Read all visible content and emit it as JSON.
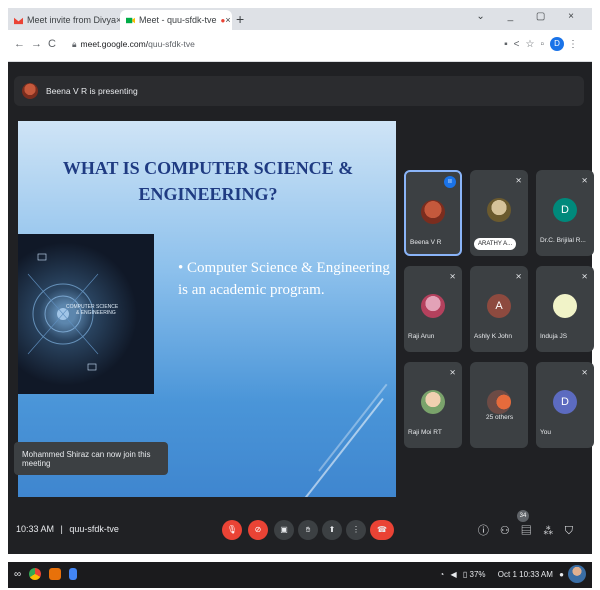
{
  "browser": {
    "tabs": [
      {
        "title": "Meet invite from Divya",
        "close": "×",
        "icon": "gmail-icon"
      },
      {
        "title": "Meet - quu-sfdk-tve",
        "close": "×",
        "icon": "meet-icon"
      }
    ],
    "new_tab": "+",
    "url_domain": "meet.google.com/",
    "url_path": "quu-sfdk-tve"
  },
  "meet": {
    "presenter_banner": "Beena V R is presenting",
    "slide": {
      "title": "WHAT IS COMPUTER SCIENCE & ENGINEERING?",
      "image_text_1": "COMPUTER SCIENCE",
      "image_text_2": "& ENGINEERING",
      "bullet": "• Computer Science & Engineering is an academic program."
    },
    "toast": "Mohammed Shiraz can now join this meeting",
    "participants": [
      {
        "name": "Beena V R",
        "speaking": true
      },
      {
        "name": "ARATHY A...",
        "pinned_label": true
      },
      {
        "name": "Dr.C. Brijilal R...",
        "initial": "D"
      },
      {
        "name": "Raji Arun"
      },
      {
        "name": "Ashly K John",
        "initial": "A"
      },
      {
        "name": "Induja JS"
      },
      {
        "name": "Raji Moi RT"
      },
      {
        "name": "25 others"
      },
      {
        "name": "You",
        "initial": "D"
      }
    ],
    "time": "10:33 AM",
    "separator": "|",
    "meeting_code": "quu-sfdk-tve",
    "people_count": "34",
    "colors": {
      "background": "#202124",
      "red": "#ea4335",
      "accent": "#1a73e8"
    }
  },
  "taskbar": {
    "battery": "37%",
    "datetime": "Oct 1 10:33 AM"
  }
}
